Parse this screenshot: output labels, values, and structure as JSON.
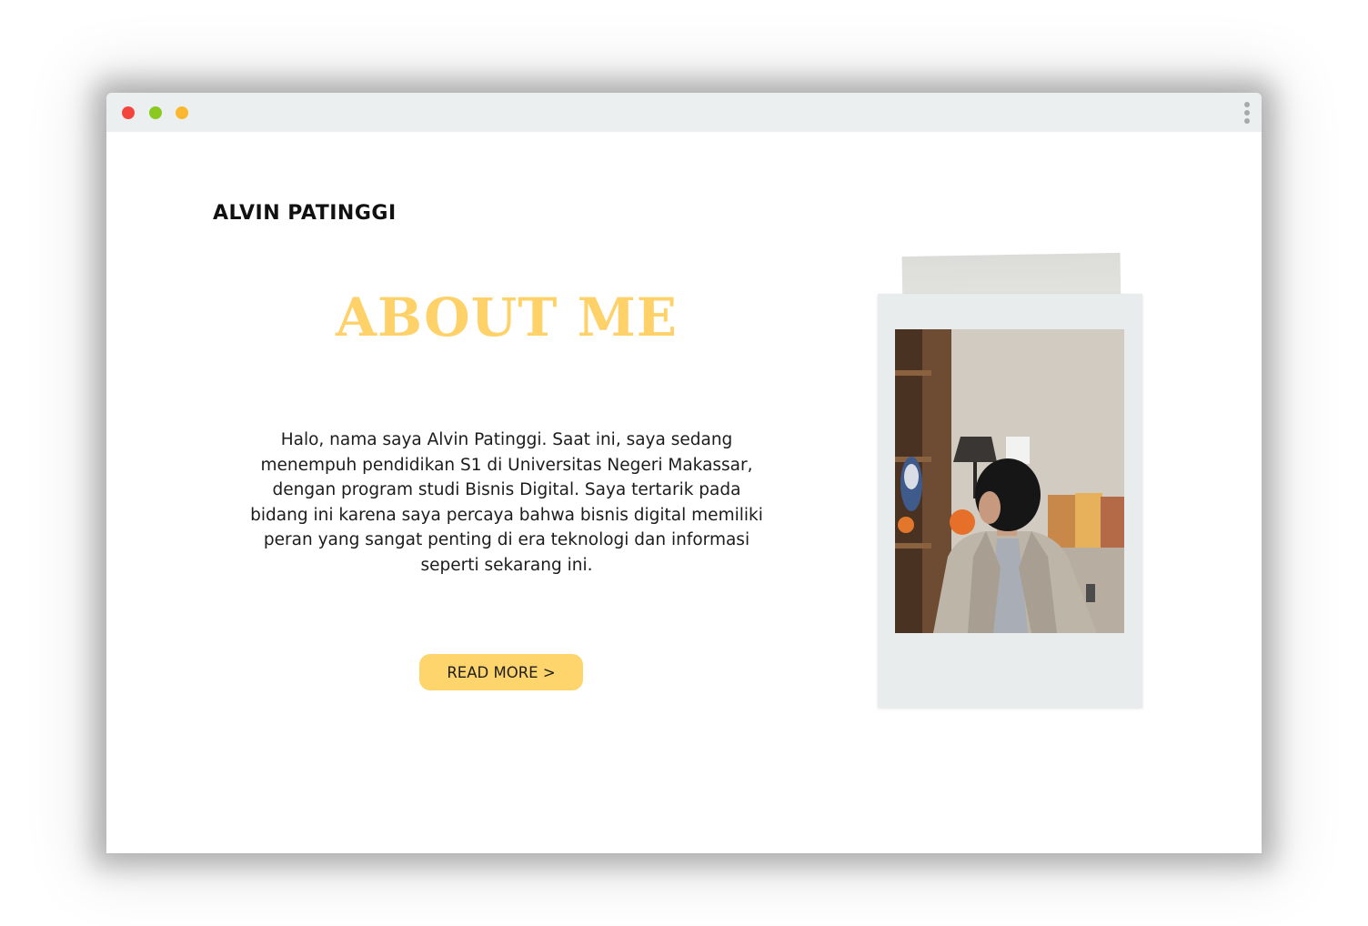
{
  "site": {
    "brand_name": "ALVIN PATINGGI"
  },
  "about": {
    "title": "ABOUT ME",
    "body": "Halo, nama saya Alvin Patinggi. Saat ini, saya sedang menempuh pendidikan S1 di Universitas Negeri Makassar, dengan program studi Bisnis Digital. Saya tertarik pada bidang ini karena saya percaya bahwa bisnis digital memiliki peran yang sangat penting di era teknologi dan informasi seperti sekarang ini.",
    "button_label": "READ MORE >"
  },
  "colors": {
    "accent": "#fed169",
    "button_bg": "#fed46c",
    "titlebar": "#eceff0",
    "dot_red": "#f4443e",
    "dot_green": "#8ac920",
    "dot_yellow": "#fbb72f"
  },
  "icons": {
    "window_controls": [
      "close-dot",
      "minimize-dot",
      "maximize-dot"
    ],
    "menu": "kebab-menu-icon"
  }
}
